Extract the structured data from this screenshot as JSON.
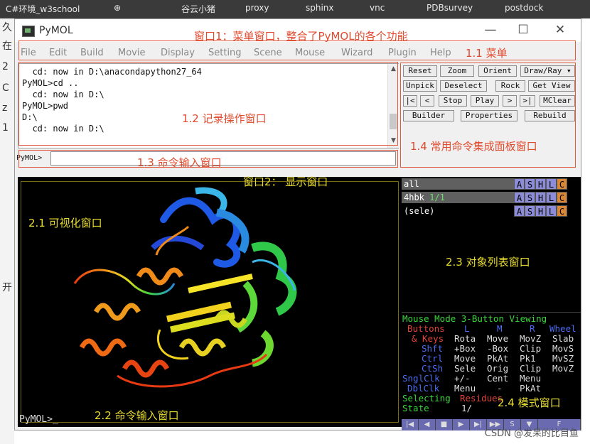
{
  "background": {
    "tabs": [
      "C#环境_w3school",
      "⊕",
      "谷云小猪",
      "proxy",
      "sphinx",
      "vnc",
      "PDBsurvey",
      "postdock"
    ],
    "left_chars": [
      "久",
      "在",
      "2",
      "C",
      "z",
      "1",
      "开"
    ]
  },
  "window": {
    "title": "PyMOL",
    "minimize": "—",
    "maximize": "☐",
    "close": "✕"
  },
  "menu": [
    "File",
    "Edit",
    "Build",
    "Movie",
    "Display",
    "Setting",
    "Scene",
    "Mouse",
    "Wizard",
    "Plugin",
    "Help"
  ],
  "log": {
    "text": "  cd: now in D:\\anacondapython27_64\nPyMOL>cd ..\n  cd: now in D:\\\nPyMOL>pwd\nD:\\\n  cd: now in D:\\"
  },
  "buttons": [
    [
      "Reset",
      "Zoom",
      "Orient",
      "Draw/Ray ▾"
    ],
    [
      "Unpick",
      "Deselect",
      "Rock",
      "Get View"
    ],
    [
      "|<",
      "<",
      "Stop",
      "Play",
      ">",
      ">|",
      "MClear"
    ],
    [
      "Builder",
      "Properties",
      "Rebuild"
    ]
  ],
  "command": {
    "label": "PyMOL>",
    "value": ""
  },
  "viewer": {
    "prompt": "PyMOL>_"
  },
  "objects": [
    {
      "name": "all",
      "extra": ""
    },
    {
      "name": "4hbk",
      "extra": "1/1"
    },
    {
      "name": "(sele)",
      "extra": ""
    }
  ],
  "object_buttons": [
    "A",
    "S",
    "H",
    "L",
    "C"
  ],
  "mouse_mode": {
    "title": "Mouse Mode 3-Button Viewing",
    "buttons_label": "Buttons",
    "cols": [
      "L",
      "M",
      "R",
      "Wheel"
    ],
    "keys_label": "& Keys",
    "rows": [
      {
        "key": "",
        "vals": [
          "Rota",
          "Move",
          "MovZ",
          "Slab"
        ]
      },
      {
        "key": "Shft",
        "vals": [
          "+Box",
          "-Box",
          "Clip",
          "MovS"
        ]
      },
      {
        "key": "Ctrl",
        "vals": [
          "Move",
          "PkAt",
          "Pk1",
          "MvSZ"
        ]
      },
      {
        "key": "CtSh",
        "vals": [
          "Sele",
          "Orig",
          "Clip",
          "MovZ"
        ]
      }
    ],
    "sngl": {
      "key": "SnglClk",
      "vals": [
        "+/-",
        "Cent",
        "Menu"
      ]
    },
    "dbl": {
      "key": "DblClk",
      "vals": [
        "Menu",
        "-",
        "PkAt"
      ]
    },
    "selecting": "Selecting",
    "residues": "Residues",
    "state_label": "State",
    "state_value": "1/"
  },
  "playbar": [
    "|◀",
    "◀",
    "■",
    "▶",
    "▶|",
    "▶▶",
    "S",
    "▼",
    "F"
  ],
  "annotations": {
    "a1": "窗口1：菜单窗口，整合了PyMOL的各个功能",
    "a11": "1.1 菜单",
    "a12": "1.2 记录操作窗口",
    "a13": "1.3 命令输入窗口",
    "a14": "1.4 常用命令集成面板窗口",
    "a2": "窗口2：   显示窗口",
    "a21": "2.1 可视化窗口",
    "a22": "2.2 命令输入窗口",
    "a23": "2.3 对象列表窗口",
    "a24": "2.4 模式窗口"
  },
  "watermark": "CSDN @发呆的比目鱼",
  "colors": {
    "annotation_red": "#e04a2e",
    "annotation_yellow": "#e8dc30",
    "mouse_green": "#39d63a",
    "mouse_red": "#e0443a",
    "mouse_blue": "#4a6cf0"
  }
}
